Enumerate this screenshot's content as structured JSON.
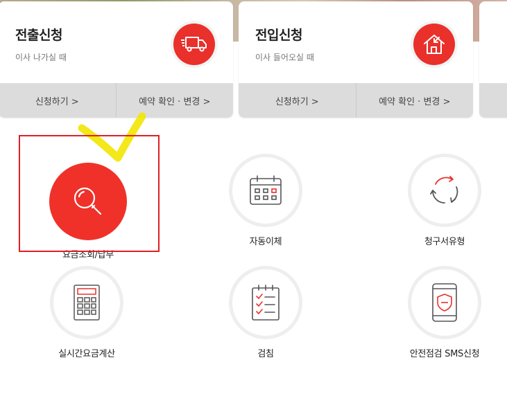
{
  "cards": [
    {
      "title": "전출신청",
      "subtitle": "이사 나가실 때",
      "icon": "moving-truck-icon",
      "apply": "신청하기 >",
      "manage": "예약 확인 · 변경 >"
    },
    {
      "title": "전입신청",
      "subtitle": "이사 들어오실 때",
      "icon": "house-arrow-in-icon",
      "apply": "신청하기 >",
      "manage": "예약 확인 · 변경 >"
    }
  ],
  "menu": [
    {
      "label": "요금조회/납부",
      "icon": "search-icon",
      "selected": true
    },
    {
      "label": "자동이체",
      "icon": "calendar-icon"
    },
    {
      "label": "청구서유형",
      "icon": "cycle-arrows-icon"
    },
    {
      "label": "실시간요금계산",
      "icon": "calculator-icon"
    },
    {
      "label": "검침",
      "icon": "checklist-icon"
    },
    {
      "label": "안전점검 SMS신청",
      "icon": "phone-shield-icon"
    }
  ],
  "colors": {
    "accent": "#ef312a",
    "highlight": "#e01e25",
    "annotation": "#f2e600",
    "footer": "#dcdcdc"
  }
}
